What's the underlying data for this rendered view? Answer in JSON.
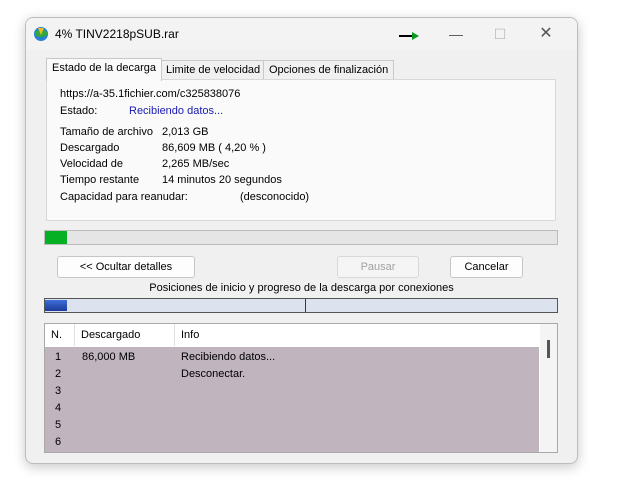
{
  "window": {
    "title": "4% TINV2218pSUB.rar"
  },
  "tabs": [
    {
      "label": "Estado de la decarga"
    },
    {
      "label": "Limite de velocidad"
    },
    {
      "label": "Opciones de finalización"
    }
  ],
  "details": {
    "url": "https://a-35.1fichier.com/c325838076",
    "estado_label": "Estado:",
    "estado_value": "Recibiendo datos...",
    "size_label": "Tamaño de archivo",
    "size_value": "2,013  GB",
    "downloaded_label": "Descargado",
    "downloaded_value": "86,609  MB  ( 4,20 % )",
    "speed_label": "Velocidad de",
    "speed_value": "2,265  MB/sec",
    "remaining_label": "Tiempo restante",
    "remaining_value": "14 minutos 20 segundos",
    "resume_label": "Capacidad para reanudar:",
    "resume_value": "(desconocido)"
  },
  "progress": {
    "percent": 4.2
  },
  "buttons": {
    "hide_details": "<< Ocultar detalles",
    "pause": "Pausar",
    "cancel": "Cancelar"
  },
  "connections": {
    "title": "Posiciones de inicio y progreso de la descarga por conexiones"
  },
  "list": {
    "headers": {
      "n": "N.",
      "downloaded": "Descargado",
      "info": "Info"
    },
    "rows": [
      {
        "n": "1",
        "downloaded": "86,000  MB",
        "info": "Recibiendo datos..."
      },
      {
        "n": "2",
        "downloaded": "",
        "info": "Desconectar."
      },
      {
        "n": "3",
        "downloaded": "",
        "info": ""
      },
      {
        "n": "4",
        "downloaded": "",
        "info": ""
      },
      {
        "n": "5",
        "downloaded": "",
        "info": ""
      },
      {
        "n": "6",
        "downloaded": "",
        "info": ""
      }
    ]
  },
  "colors": {
    "progress": "#06b025",
    "status_text": "#1a1ab0",
    "list_bg": "#c0b4bf"
  }
}
